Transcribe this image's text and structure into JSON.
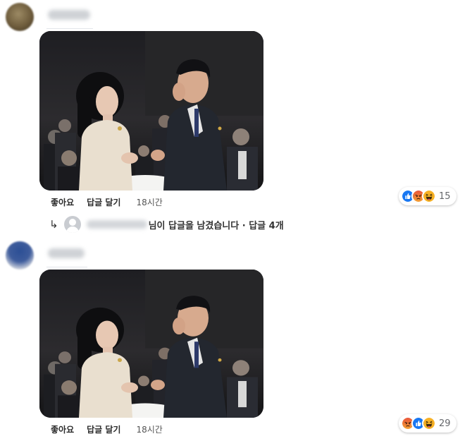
{
  "comments": [
    {
      "actions": {
        "like": "좋아요",
        "reply": "답글 달기",
        "time": "18시간"
      },
      "reactions": {
        "icons": [
          "like-icon",
          "angry-icon",
          "haha-icon"
        ],
        "count": "15"
      },
      "replies_summary": {
        "text": "님이 답글을 남겼습니다 · 답글 4개"
      }
    },
    {
      "actions": {
        "like": "좋아요",
        "reply": "답글 달기",
        "time": "18시간"
      },
      "reactions": {
        "icons": [
          "angry-icon",
          "like-icon",
          "haha-icon"
        ],
        "count": "29"
      }
    }
  ],
  "colors": {
    "like": "#1877f2",
    "angry": "#e9710f",
    "haha": "#f7b125",
    "meta_text": "#65676b"
  }
}
